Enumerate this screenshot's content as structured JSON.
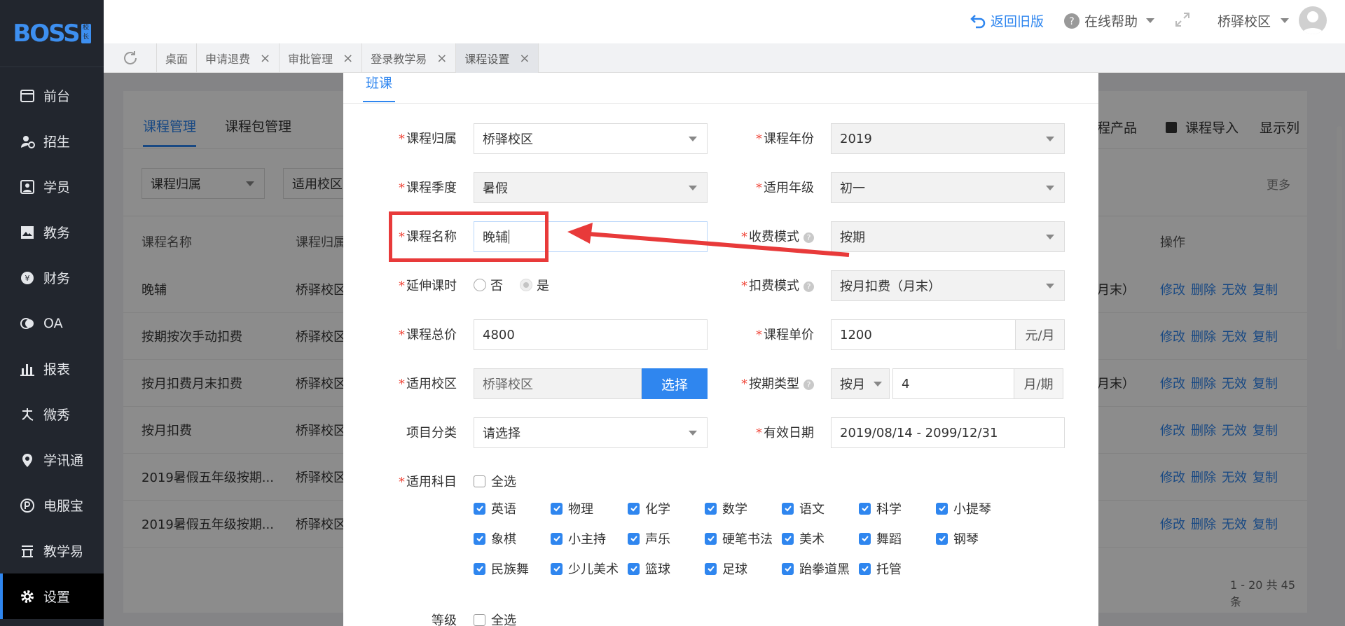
{
  "sidebar": {
    "logo": "BOSS",
    "logo_badge": "校长",
    "items": [
      {
        "label": "前台",
        "icon": "calendar-icon"
      },
      {
        "label": "招生",
        "icon": "add-user-icon"
      },
      {
        "label": "学员",
        "icon": "student-card-icon"
      },
      {
        "label": "教务",
        "icon": "book-icon"
      },
      {
        "label": "财务",
        "icon": "yen-icon"
      },
      {
        "label": "OA",
        "icon": "oa-icon"
      },
      {
        "label": "报表",
        "icon": "bar-chart-icon"
      },
      {
        "label": "微秀",
        "icon": "weixiu-icon"
      },
      {
        "label": "学讯通",
        "icon": "location-pin-icon"
      },
      {
        "label": "电服宝",
        "icon": "phone-icon"
      },
      {
        "label": "教学易",
        "icon": "teaching-icon"
      },
      {
        "label": "设置",
        "icon": "gear-icon"
      }
    ]
  },
  "header": {
    "back_old": "返回旧版",
    "help": "在线帮助",
    "campus": "桥驿校区"
  },
  "tabs": [
    {
      "label": "桌面",
      "closable": false
    },
    {
      "label": "申请退费",
      "closable": true
    },
    {
      "label": "审批管理",
      "closable": true
    },
    {
      "label": "登录教学易",
      "closable": true
    },
    {
      "label": "课程设置",
      "closable": true
    }
  ],
  "background": {
    "subtabs": [
      "课程管理",
      "课程包管理"
    ],
    "filter1": "课程归属",
    "filter2": "适用校区",
    "toolbar": [
      "程产品",
      "课程导入",
      "显示列"
    ],
    "more": "更多",
    "col_name": "课程名称",
    "col_owner": "课程归属",
    "col_ops": "操作",
    "rows": [
      {
        "name": "晚辅",
        "owner": "桥驿校区",
        "extra": "月末）"
      },
      {
        "name": "按期按次手动扣费",
        "owner": "桥驿校区",
        "extra": ""
      },
      {
        "name": "按月扣费月末扣费",
        "owner": "桥驿校区",
        "extra": "月末）"
      },
      {
        "name": "按月扣费",
        "owner": "桥驿校区",
        "extra": ""
      },
      {
        "name": "2019暑假五年级按期...",
        "owner": "桥驿校区",
        "extra": ""
      },
      {
        "name": "2019暑假五年级按期...",
        "owner": "桥驿校区",
        "extra": ""
      }
    ],
    "ops": [
      "修改",
      "删除",
      "无效",
      "复制"
    ],
    "pagination": "1 - 20   共 45 条"
  },
  "modal": {
    "tab": "班课",
    "fields": {
      "owner": {
        "label": "课程归属",
        "value": "桥驿校区"
      },
      "year": {
        "label": "课程年份",
        "value": "2019"
      },
      "season": {
        "label": "课程季度",
        "value": "暑假"
      },
      "grade": {
        "label": "适用年级",
        "value": "初一"
      },
      "name": {
        "label": "课程名称",
        "value": "晚辅"
      },
      "charge_mode": {
        "label": "收费模式",
        "value": "按期"
      },
      "extend": {
        "label": "延伸课时",
        "opt_no": "否",
        "opt_yes": "是"
      },
      "deduct_mode": {
        "label": "扣费模式",
        "value": "按月扣费（月末）"
      },
      "total_price": {
        "label": "课程总价",
        "value": "4800"
      },
      "unit_price": {
        "label": "课程单价",
        "value": "1200",
        "unit": "元/月"
      },
      "campus": {
        "label": "适用校区",
        "value": "桥驿校区",
        "button": "选择"
      },
      "period_type": {
        "label": "按期类型",
        "value": "按月",
        "count": "4",
        "unit": "月/期"
      },
      "category": {
        "label": "项目分类",
        "value": "请选择"
      },
      "valid_date": {
        "label": "有效日期",
        "value": "2019/08/14 - 2099/12/31"
      },
      "subjects": {
        "label": "适用科目",
        "select_all": "全选"
      },
      "level": {
        "label": "等级",
        "select_all": "全选"
      }
    },
    "subjects": [
      [
        "英语",
        "物理",
        "化学",
        "数学",
        "语文",
        "科学",
        "小提琴"
      ],
      [
        "象棋",
        "小主持",
        "声乐",
        "硬笔书法",
        "美术",
        "舞蹈",
        "钢琴"
      ],
      [
        "民族舞",
        "少儿美术",
        "篮球",
        "足球",
        "跆拳道黑",
        "托管"
      ]
    ]
  },
  "colors": {
    "accent": "#2f86ef",
    "highlight": "#e83a3a",
    "sidebar": "#22262e"
  }
}
